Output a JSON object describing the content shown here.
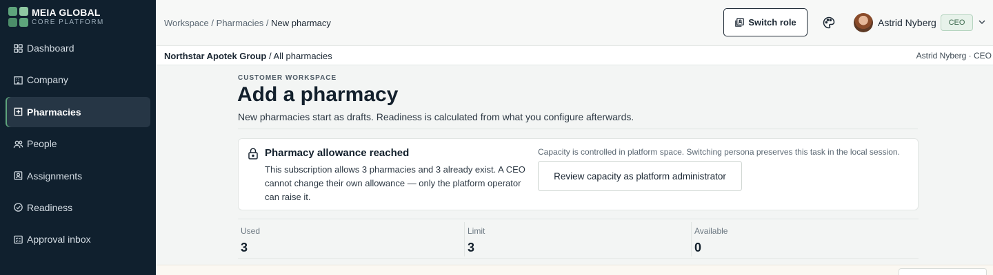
{
  "brand": {
    "name": "MEIA GLOBAL",
    "subtitle": "CORE PLATFORM"
  },
  "sidebar": {
    "items": [
      {
        "label": "Dashboard",
        "icon": "grid-icon",
        "active": false
      },
      {
        "label": "Company",
        "icon": "building-icon",
        "active": false
      },
      {
        "label": "Pharmacies",
        "icon": "pharmacy-icon",
        "active": true
      },
      {
        "label": "People",
        "icon": "people-icon",
        "active": false
      },
      {
        "label": "Assignments",
        "icon": "badge-icon",
        "active": false
      },
      {
        "label": "Readiness",
        "icon": "check-circle-icon",
        "active": false
      },
      {
        "label": "Approval inbox",
        "icon": "inbox-icon",
        "active": false
      }
    ]
  },
  "header": {
    "breadcrumb": [
      "Workspace",
      "Pharmacies",
      "New pharmacy"
    ],
    "switch_role_label": "Switch role",
    "user_name": "Astrid Nyberg",
    "role_badge": "CEO"
  },
  "context": {
    "org_name": "Northstar Apotek Group",
    "org_scope": "All pharmacies",
    "user_role": "Astrid Nyberg · CEO"
  },
  "main": {
    "eyebrow": "CUSTOMER WORKSPACE",
    "title": "Add a pharmacy",
    "subtitle": "New pharmacies start as drafts. Readiness is calculated from what you configure afterwards.",
    "alert": {
      "title": "Pharmacy allowance reached",
      "body": "This subscription allows 3 pharmacies and 3 already exist. A CEO cannot change their own allowance — only the platform operator can raise it.",
      "note": "Capacity is controlled in platform space. Switching persona preserves this task in the local session.",
      "action_label": "Review capacity as platform administrator"
    },
    "stats": [
      {
        "label": "Used",
        "value": "3"
      },
      {
        "label": "Limit",
        "value": "3"
      },
      {
        "label": "Available",
        "value": "0"
      }
    ]
  },
  "colors": {
    "sidebar_bg": "#10202e",
    "accent": "#5ea57c",
    "badge_bg": "#e7f2ea"
  }
}
